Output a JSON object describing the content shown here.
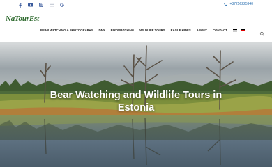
{
  "topbar": {
    "socials": [
      "facebook-icon",
      "youtube-icon",
      "instagram-icon",
      "tripadvisor-icon",
      "google-icon"
    ],
    "phone": "+37256225940"
  },
  "header": {
    "logo_text": "NaTourEst",
    "nav": [
      {
        "label": "BEAR WATCHING & PHOTOGRAPHY"
      },
      {
        "label": "DNX"
      },
      {
        "label": "BIRDWATCHING"
      },
      {
        "label": "WILDLIFE TOURS"
      },
      {
        "label": "EAGLE HIDES"
      },
      {
        "label": "ABOUT"
      },
      {
        "label": "CONTACT"
      }
    ],
    "languages": [
      "Estonian",
      "German"
    ]
  },
  "hero": {
    "title_line1": "Bear Watching and Wildlife Tours in",
    "title_line2": "Estonia"
  },
  "colors": {
    "accent": "#2a6fb0",
    "logo": "#2e6a2e"
  }
}
